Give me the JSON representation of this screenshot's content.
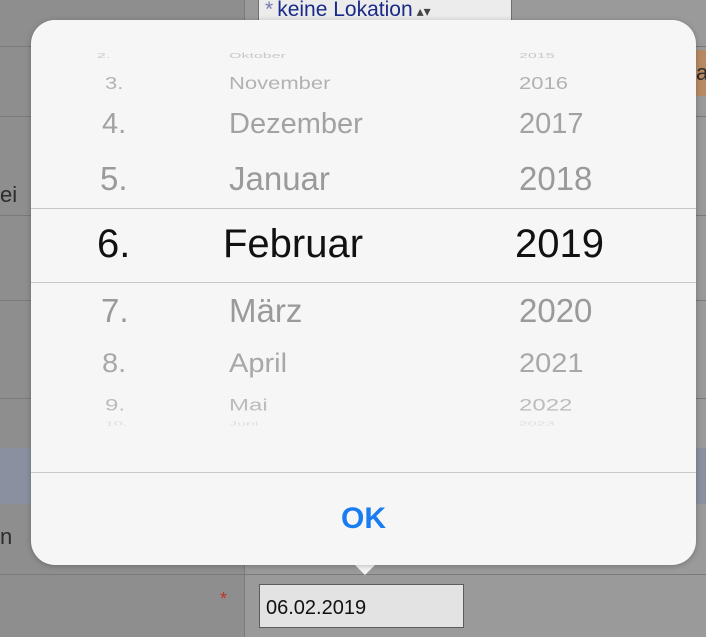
{
  "background": {
    "location_select": {
      "star": "*",
      "value": "keine Lokation",
      "arrows": "▴▾"
    },
    "left_fragments": [
      "ei",
      "n"
    ],
    "right_fragment": "a",
    "required_marker": "*",
    "date_field_value": "06.02.2019"
  },
  "picker": {
    "rows": [
      {
        "day": "2.",
        "month": "Oktober",
        "year": "2015"
      },
      {
        "day": "3.",
        "month": "November",
        "year": "2016"
      },
      {
        "day": "4.",
        "month": "Dezember",
        "year": "2017"
      },
      {
        "day": "5.",
        "month": "Januar",
        "year": "2018"
      },
      {
        "day": "6.",
        "month": "Februar",
        "year": "2019"
      },
      {
        "day": "7.",
        "month": "März",
        "year": "2020"
      },
      {
        "day": "8.",
        "month": "April",
        "year": "2021"
      },
      {
        "day": "9.",
        "month": "Mai",
        "year": "2022"
      },
      {
        "day": "10.",
        "month": "Juni",
        "year": "2023"
      }
    ],
    "selected": {
      "day": "6.",
      "month": "Februar",
      "year": "2019"
    }
  },
  "ok_label": "OK",
  "colors": {
    "accent": "#1a7cf3",
    "selected_text": "#111111",
    "unselected_text": "#9a9a9a"
  }
}
